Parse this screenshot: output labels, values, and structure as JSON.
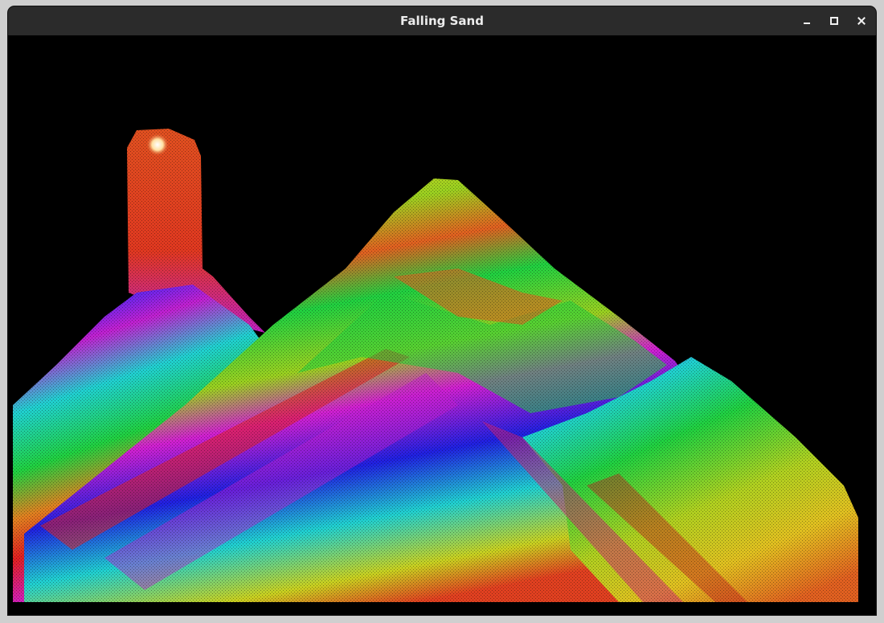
{
  "window": {
    "title": "Falling Sand",
    "controls": {
      "minimize": "minimize-icon",
      "maximize": "maximize-icon",
      "close": "close-icon"
    }
  },
  "scene": {
    "background": "#000000",
    "palette": [
      "#ff0000",
      "#ff8000",
      "#ffff00",
      "#00ff00",
      "#00ffff",
      "#0000ff",
      "#ff00ff"
    ],
    "features": [
      "sand-column",
      "sand-pile-left",
      "sand-pile-center",
      "sand-pile-right",
      "spawn-point"
    ]
  }
}
